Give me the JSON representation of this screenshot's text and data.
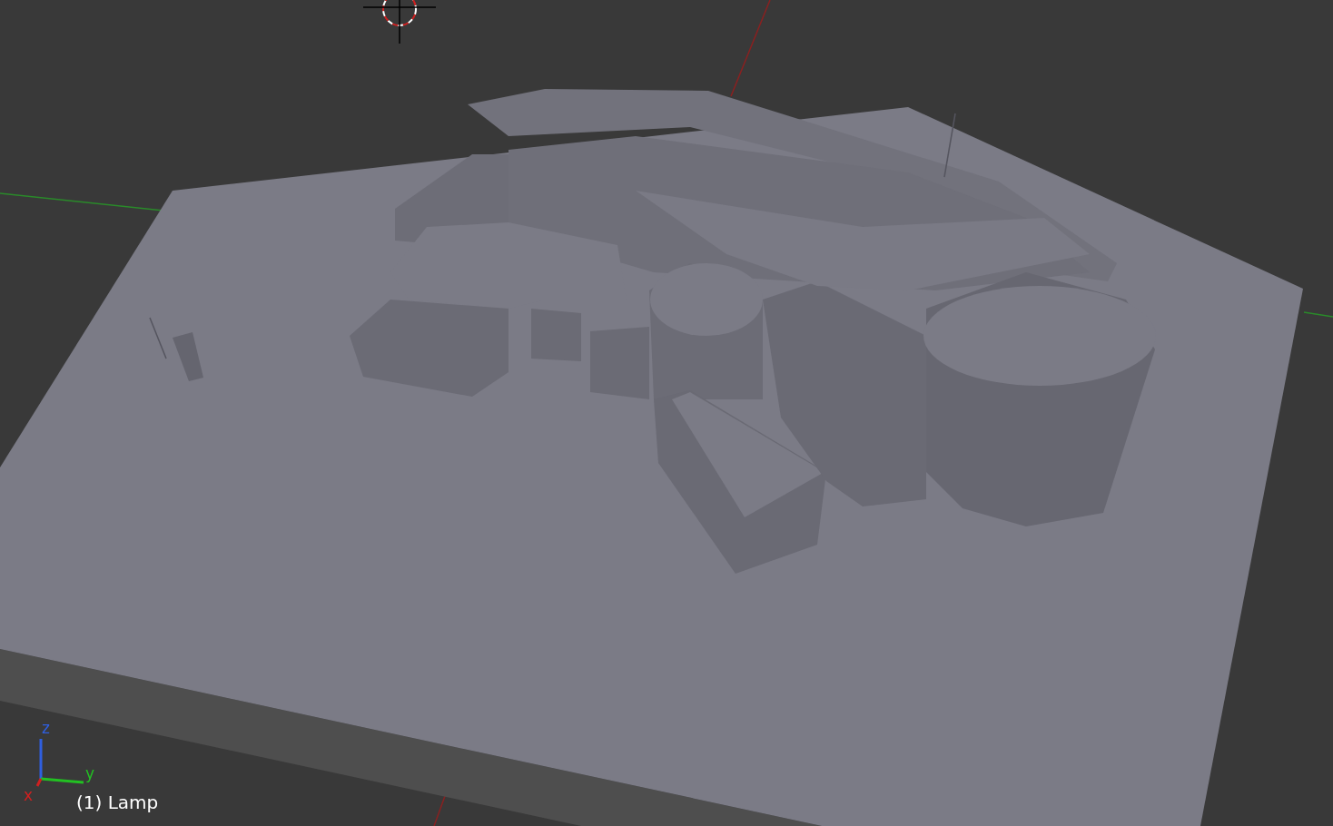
{
  "viewport": {
    "object_label": "(1) Lamp",
    "axis_gizmo": [
      {
        "axis": "z",
        "color": "#2f5fe0"
      },
      {
        "axis": "y",
        "color": "#22c022"
      },
      {
        "axis": "x",
        "color": "#d02020"
      }
    ]
  }
}
